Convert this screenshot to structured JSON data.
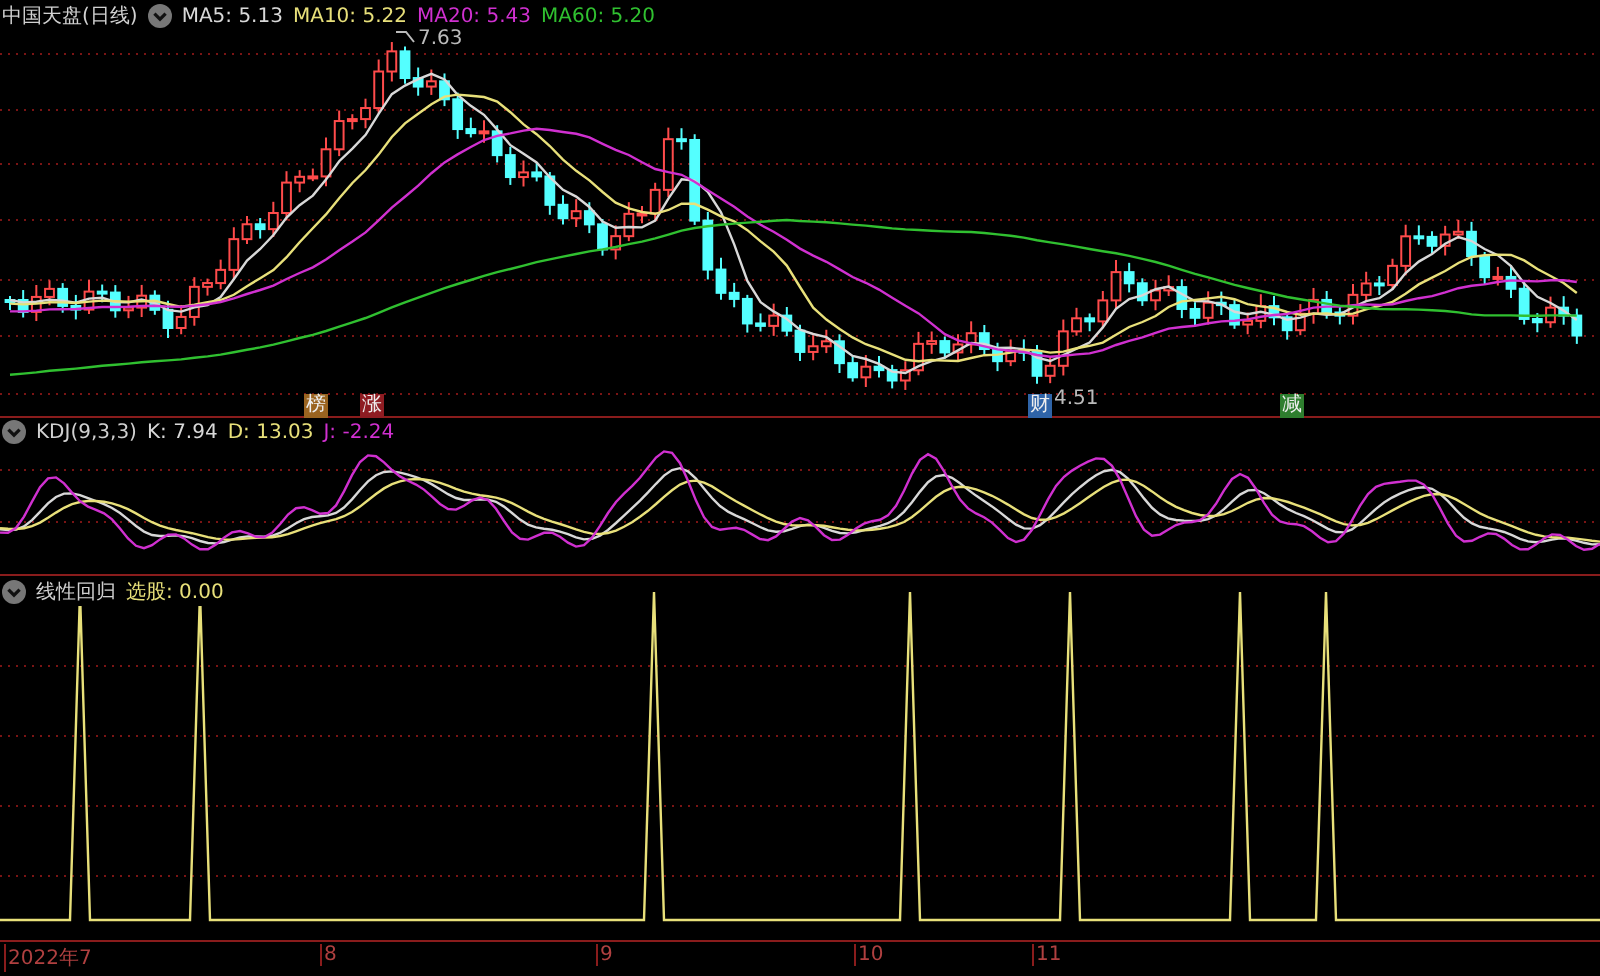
{
  "price_panel": {
    "title": "中国天盘(日线)",
    "legend": [
      {
        "label": "MA5: 5.13",
        "color": "#d8d8d8"
      },
      {
        "label": "MA10: 5.22",
        "color": "#e8e07a"
      },
      {
        "label": "MA20: 5.43",
        "color": "#d030d0"
      },
      {
        "label": "MA60: 5.20",
        "color": "#30c030"
      }
    ],
    "high_label": "7.63",
    "low_label": "4.51",
    "tags": [
      {
        "text": "榜",
        "color": "#9a6420"
      },
      {
        "text": "涨",
        "color": "#8e1c22"
      },
      {
        "text": "财",
        "color": "#2f64a8"
      },
      {
        "text": "减",
        "color": "#2e7e2e"
      }
    ]
  },
  "kdj_panel": {
    "title": "KDJ(9,3,3)",
    "legend": [
      {
        "label": "K: 7.94",
        "color": "#d8d8d8"
      },
      {
        "label": "D: 13.03",
        "color": "#e8e07a"
      },
      {
        "label": "J: -2.24",
        "color": "#d030d0"
      }
    ]
  },
  "regression_panel": {
    "title": "线性回归",
    "legend": [
      {
        "label": "选股: 0.00",
        "color": "#e8e07a"
      }
    ]
  },
  "x_axis": {
    "labels": [
      "2022年7",
      "8",
      "9",
      "10",
      "11"
    ]
  }
}
